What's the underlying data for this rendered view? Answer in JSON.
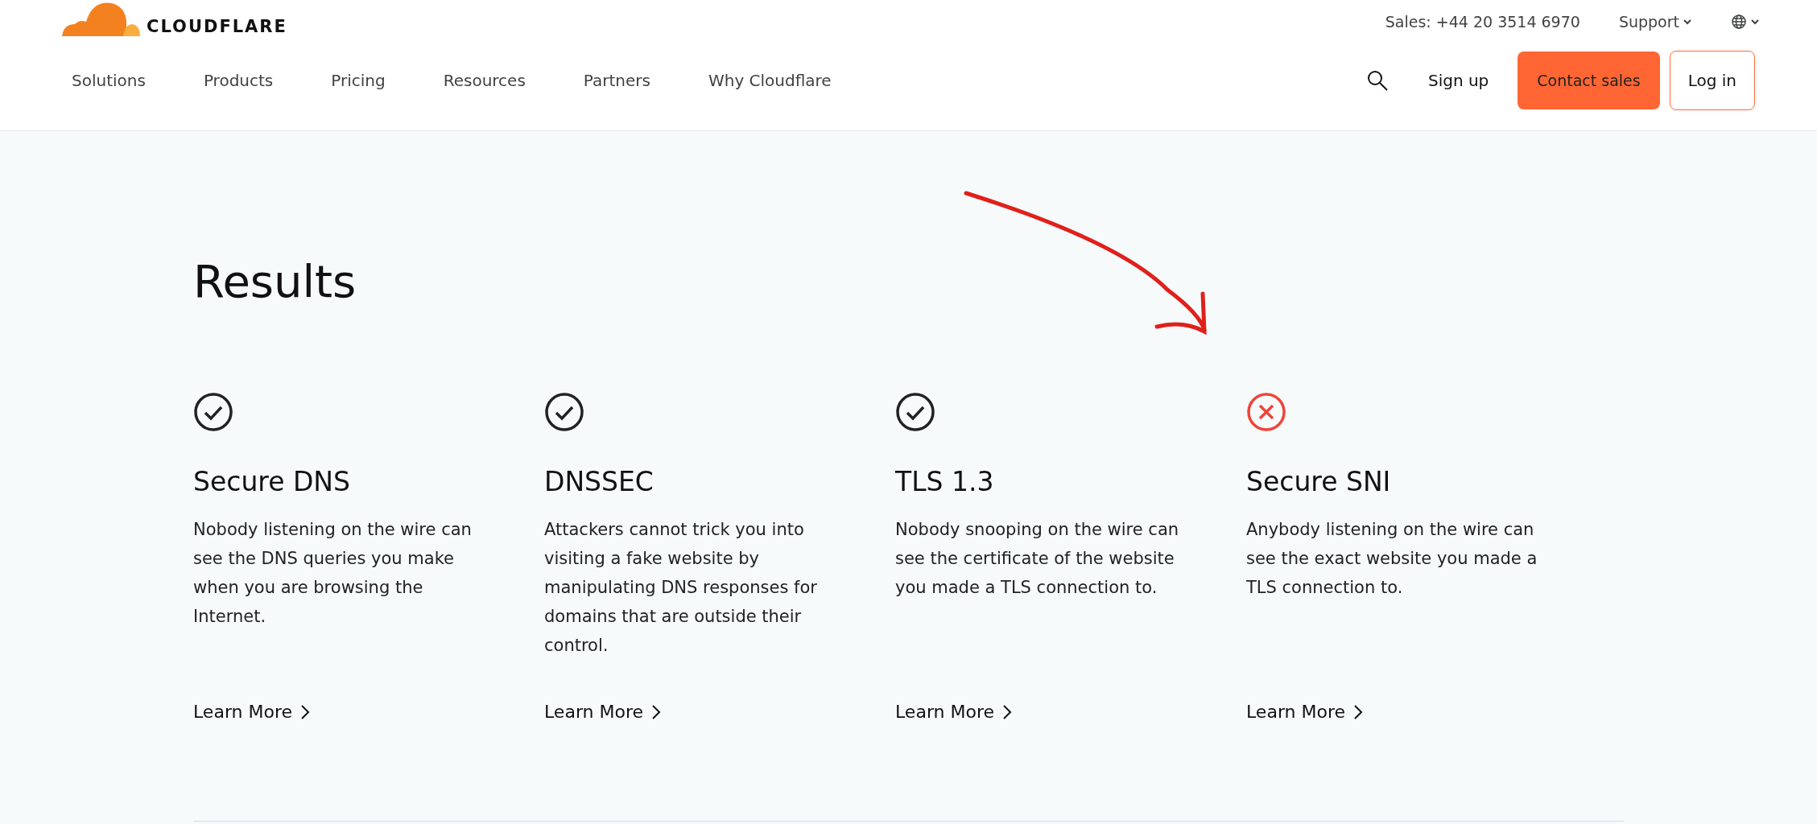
{
  "header": {
    "logo": "CLOUDFLARE",
    "sales": "Sales: +44 20 3514 6970",
    "support": "Support",
    "nav": [
      "Solutions",
      "Products",
      "Pricing",
      "Resources",
      "Partners",
      "Why Cloudflare"
    ],
    "sign_up": "Sign up",
    "contact_sales": "Contact sales",
    "log_in": "Log in"
  },
  "results": {
    "title": "Results",
    "items": [
      {
        "title": "Secure DNS",
        "passed": true,
        "description": "Nobody listening on the wire can see the DNS queries you make when you are browsing the Internet.",
        "link": "Learn More"
      },
      {
        "title": "DNSSEC",
        "passed": true,
        "description": "Attackers cannot trick you into visiting a fake website by manipulating DNS responses for domains that are outside their control.",
        "link": "Learn More"
      },
      {
        "title": "TLS 1.3",
        "passed": true,
        "description": "Nobody snooping on the wire can see the certificate of the website you made a TLS connection to.",
        "link": "Learn More"
      },
      {
        "title": "Secure SNI",
        "passed": false,
        "description": "Anybody listening on the wire can see the exact website you made a TLS connection to.",
        "link": "Learn More"
      }
    ]
  }
}
